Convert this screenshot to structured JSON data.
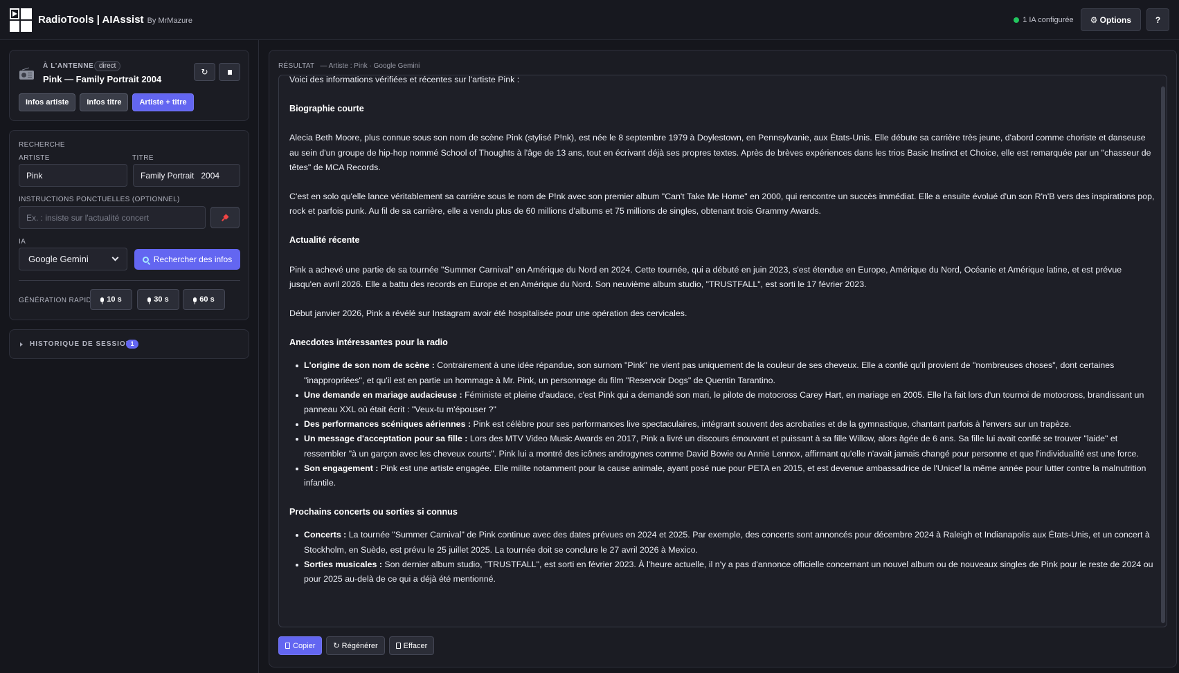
{
  "app": {
    "title": "RadioTools | AIAssist",
    "by": "By MrMazure",
    "status": "1 IA configurée",
    "options_label": "⚙ Options",
    "help_label": "?"
  },
  "now_playing": {
    "label": "À L'ANTENNE",
    "badge": "direct",
    "title": "Pink — Family Portrait 2004",
    "refresh_label": "↻",
    "chips": [
      "Infos artiste",
      "Infos titre",
      "Artiste + titre"
    ],
    "active_chip": "Artiste + titre"
  },
  "search": {
    "section_label": "RECHERCHE",
    "artist_label": "ARTISTE",
    "artist_value": "Pink",
    "title_label": "TITRE",
    "title_value": "Family Portrait   2004",
    "instructions_label": "INSTRUCTIONS PONCTUELLES (OPTIONNEL)",
    "instructions_placeholder": "Ex. : insiste sur l'actualité concert",
    "ia_label": "IA",
    "ia_selected": "Google Gemini",
    "search_button": "Rechercher des infos",
    "quick_label": "GÉNÉRATION RAPIDE",
    "quick_buttons": [
      "10 s",
      "30 s",
      "60 s"
    ]
  },
  "history": {
    "label": "HISTORIQUE DE SESSION",
    "count": "1"
  },
  "result": {
    "label": "RÉSULTAT",
    "sub": "— Artiste : Pink · Google Gemini",
    "intro": "Voici des informations vérifiées et récentes sur l'artiste Pink :",
    "h_bio": "Biographie courte",
    "bio_1": "Alecia Beth Moore, plus connue sous son nom de scène Pink (stylisé P!nk), est née le 8 septembre 1979 à Doylestown, en Pennsylvanie, aux États-Unis. Elle débute sa carrière très jeune, d'abord comme choriste et danseuse au sein d'un groupe de hip-hop nommé School of Thoughts à l'âge de 13 ans, tout en écrivant déjà ses propres textes. Après de brèves expériences dans les trios Basic Instinct et Choice, elle est remarquée par un \"chasseur de têtes\" de MCA Records.",
    "bio_2": "C'est en solo qu'elle lance véritablement sa carrière sous le nom de P!nk avec son premier album \"Can't Take Me Home\" en 2000, qui rencontre un succès immédiat. Elle a ensuite évolué d'un son R'n'B vers des inspirations pop, rock et parfois punk. Au fil de sa carrière, elle a vendu plus de 60 millions d'albums et 75 millions de singles, obtenant trois Grammy Awards.",
    "h_news": "Actualité récente",
    "news_1": "Pink a achevé une partie de sa tournée \"Summer Carnival\" en Amérique du Nord en 2024. Cette tournée, qui a débuté en juin 2023, s'est étendue en Europe, Amérique du Nord, Océanie et Amérique latine, et est prévue jusqu'en avril 2026. Elle a battu des records en Europe et en Amérique du Nord. Son neuvième album studio, \"TRUSTFALL\", est sorti le 17 février 2023.",
    "news_2": "Début janvier 2026, Pink a révélé sur Instagram avoir été hospitalisée pour une opération des cervicales.",
    "h_anec": "Anecdotes intéressantes pour la radio",
    "anecdotes": [
      {
        "title": "L'origine de son nom de scène :",
        "text": " Contrairement à une idée répandue, son surnom \"Pink\" ne vient pas uniquement de la couleur de ses cheveux. Elle a confié qu'il provient de \"nombreuses choses\", dont certaines \"inappropriées\", et qu'il est en partie un hommage à Mr. Pink, un personnage du film \"Reservoir Dogs\" de Quentin Tarantino."
      },
      {
        "title": "Une demande en mariage audacieuse :",
        "text": " Féministe et pleine d'audace, c'est Pink qui a demandé son mari, le pilote de motocross Carey Hart, en mariage en 2005. Elle l'a fait lors d'un tournoi de motocross, brandissant un panneau XXL où était écrit : \"Veux-tu m'épouser ?\""
      },
      {
        "title": "Des performances scéniques aériennes :",
        "text": " Pink est célèbre pour ses performances live spectaculaires, intégrant souvent des acrobaties et de la gymnastique, chantant parfois à l'envers sur un trapèze."
      },
      {
        "title": "Un message d'acceptation pour sa fille :",
        "text": " Lors des MTV Video Music Awards en 2017, Pink a livré un discours émouvant et puissant à sa fille Willow, alors âgée de 6 ans. Sa fille lui avait confié se trouver \"laide\" et ressembler \"à un garçon avec les cheveux courts\". Pink lui a montré des icônes androgynes comme David Bowie ou Annie Lennox, affirmant qu'elle n'avait jamais changé pour personne et que l'individualité est une force."
      },
      {
        "title": "Son engagement :",
        "text": " Pink est une artiste engagée. Elle milite notamment pour la cause animale, ayant posé nue pour PETA en 2015, et est devenue ambassadrice de l'Unicef la même année pour lutter contre la malnutrition infantile."
      }
    ],
    "h_next": "Prochains concerts ou sorties si connus",
    "next": [
      {
        "title": "Concerts :",
        "text": " La tournée \"Summer Carnival\" de Pink continue avec des dates prévues en 2024 et 2025. Par exemple, des concerts sont annoncés pour décembre 2024 à Raleigh et Indianapolis aux États-Unis, et un concert à Stockholm, en Suède, est prévu le 25 juillet 2025. La tournée doit se conclure le 27 avril 2026 à Mexico."
      },
      {
        "title": "Sorties musicales :",
        "text": " Son dernier album studio, \"TRUSTFALL\", est sorti en février 2023. À l'heure actuelle, il n'y a pas d'annonce officielle concernant un nouvel album ou de nouveaux singles de Pink pour le reste de 2024 ou pour 2025 au-delà de ce qui a déjà été mentionné."
      }
    ]
  },
  "actions": {
    "copy": "Copier",
    "regen": "↻ Régénérer",
    "clear": "Effacer"
  }
}
